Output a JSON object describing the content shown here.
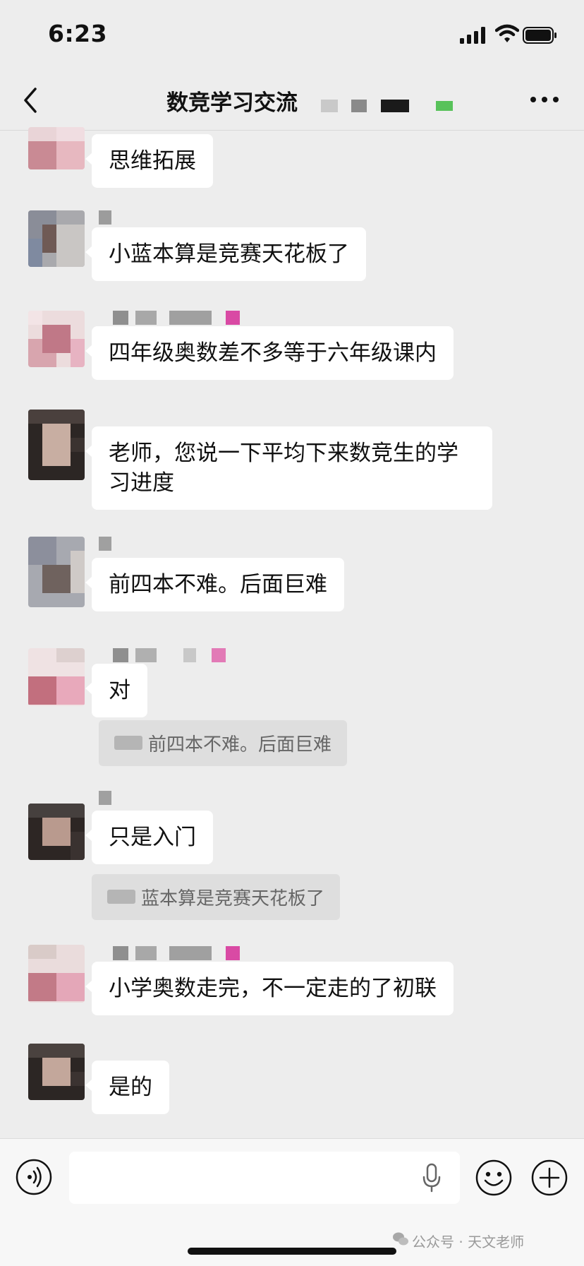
{
  "status": {
    "time": "6:23"
  },
  "nav": {
    "title": "数竞学习交流"
  },
  "messages": [
    {
      "text": "思维拓展"
    },
    {
      "text": "小蓝本算是竞赛天花板了"
    },
    {
      "text": "四年级奥数差不多等于六年级课内"
    },
    {
      "text": "老师，您说一下平均下来数竞生的学习进度"
    },
    {
      "text": "前四本不难。后面巨难"
    },
    {
      "text": "对",
      "quote": "前四本不难。后面巨难"
    },
    {
      "text": "只是入门",
      "quote": "蓝本算是竞赛天花板了"
    },
    {
      "text": "小学奥数走完，不一定走的了初联"
    },
    {
      "text": "是的"
    }
  ],
  "input": {
    "placeholder": ""
  },
  "watermark": "公众号 · 天文老师",
  "colors": {
    "background": "#ededed",
    "bubble": "#ffffff",
    "quote": "#dedede",
    "input_bar": "#f7f7f7"
  }
}
